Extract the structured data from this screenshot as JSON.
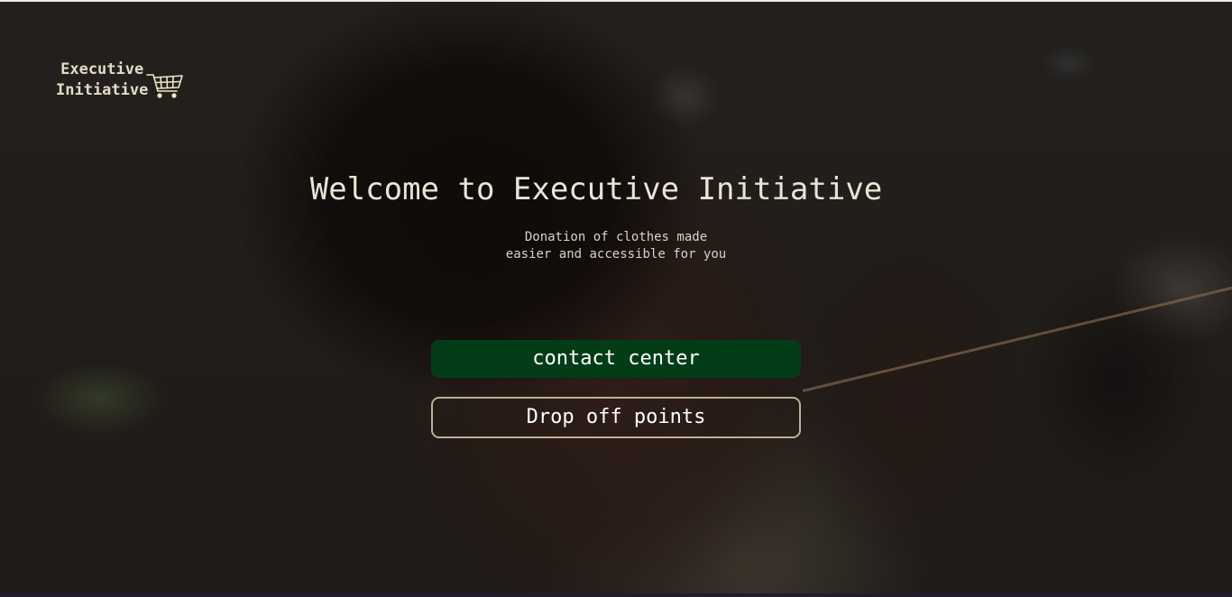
{
  "brand": {
    "name_line1": "Executive",
    "name_line2": "Initiative",
    "logo_icon": "shopping-cart-icon"
  },
  "hero": {
    "title": "Welcome to Executive Initiative",
    "subtitle_line1": "Donation of clothes made",
    "subtitle_line2": "easier and accessible for you"
  },
  "actions": {
    "contact_label": "contact center",
    "dropoff_label": "Drop off points"
  },
  "colors": {
    "primary_button": "#033d17",
    "outline_button_border": "#bfae93",
    "logo_text": "#e3dbc6",
    "title_text": "#e9e4d6"
  }
}
